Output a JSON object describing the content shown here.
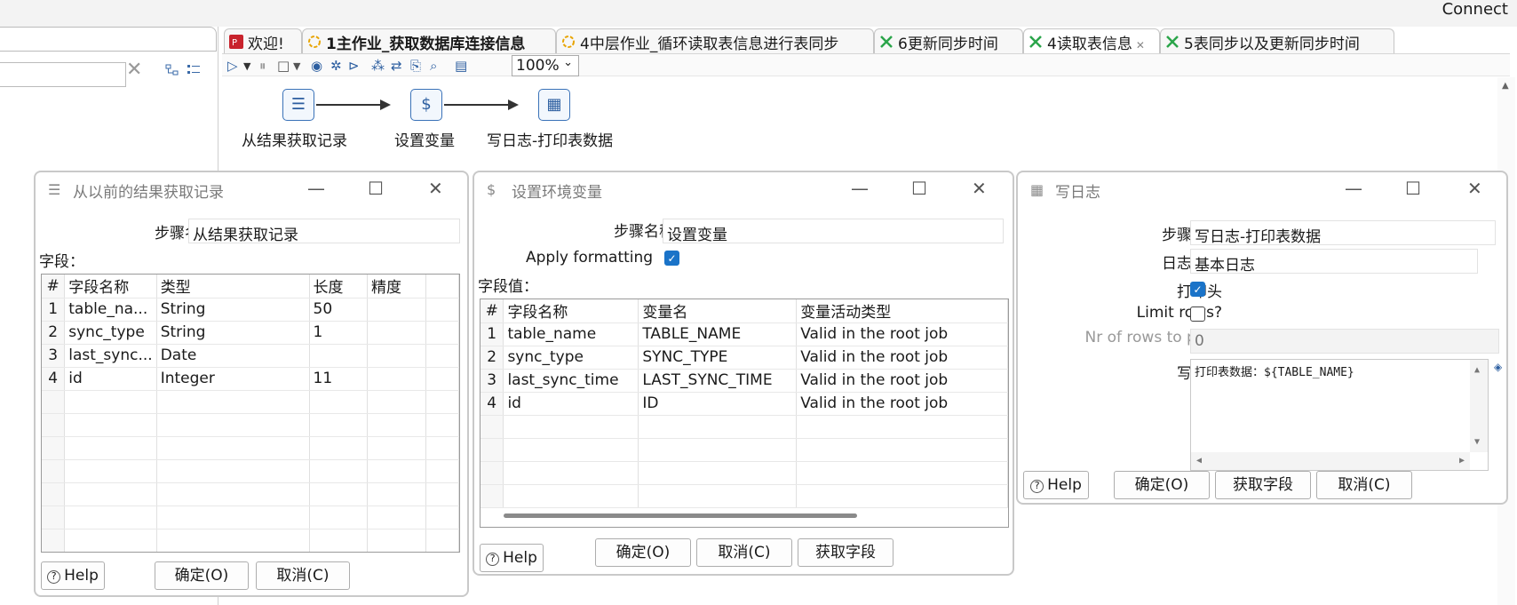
{
  "app": {
    "connect_label": "Connect"
  },
  "tabs": [
    {
      "label": "欢迎!",
      "icon": "welcome-icon",
      "bold": false,
      "active": false
    },
    {
      "label": "1主作业_获取数据库连接信息",
      "icon": "job-icon",
      "bold": true,
      "active": false
    },
    {
      "label": "4中层作业_循环读取表信息进行表同步",
      "icon": "job-icon",
      "bold": false,
      "active": false
    },
    {
      "label": "6更新同步时间",
      "icon": "transformation-icon",
      "bold": false,
      "active": false
    },
    {
      "label": "4读取表信息",
      "icon": "transformation-icon",
      "bold": false,
      "active": true
    },
    {
      "label": "5表同步以及更新同步时间",
      "icon": "transformation-icon",
      "bold": false,
      "active": false
    }
  ],
  "toolbar": {
    "zoom": "100%"
  },
  "canvas": {
    "steps": [
      {
        "label": "从结果获取记录",
        "icon": "get-rows-icon"
      },
      {
        "label": "设置变量",
        "icon": "set-variables-icon"
      },
      {
        "label": "写日志-打印表数据",
        "icon": "write-log-icon"
      }
    ]
  },
  "dialog1": {
    "title": "从以前的结果获取记录",
    "step_name_label": "步骤名称",
    "step_name_value": "从结果获取记录",
    "fields_label": "字段：",
    "columns": [
      "#",
      "字段名称",
      "类型",
      "长度",
      "精度"
    ],
    "rows": [
      [
        "1",
        "table_na...",
        "String",
        "50",
        ""
      ],
      [
        "2",
        "sync_type",
        "String",
        "1",
        ""
      ],
      [
        "3",
        "last_sync...",
        "Date",
        "",
        ""
      ],
      [
        "4",
        "id",
        "Integer",
        "11",
        ""
      ]
    ],
    "help": "Help",
    "ok": "确定(O)",
    "cancel": "取消(C)"
  },
  "dialog2": {
    "title": "设置环境变量",
    "step_name_label": "步骤名称：",
    "step_name_value": "设置变量",
    "apply_formatting_label": "Apply formatting",
    "apply_formatting": true,
    "values_label": "字段值：",
    "columns": [
      "#",
      "字段名称",
      "变量名",
      "变量活动类型"
    ],
    "rows": [
      [
        "1",
        "table_name",
        "TABLE_NAME",
        "Valid in the root job"
      ],
      [
        "2",
        "sync_type",
        "SYNC_TYPE",
        "Valid in the root job"
      ],
      [
        "3",
        "last_sync_time",
        "LAST_SYNC_TIME",
        "Valid in the root job"
      ],
      [
        "4",
        "id",
        "ID",
        "Valid in the root job"
      ]
    ],
    "help": "Help",
    "ok": "确定(O)",
    "cancel": "取消(C)",
    "get_fields": "获取字段"
  },
  "dialog3": {
    "title": "写日志",
    "step_name_label": "步骤名称",
    "step_name_value": "写日志-打印表数据",
    "log_level_label": "日志级别",
    "log_level_value": "基本日志",
    "print_header_label": "打印头",
    "print_header": true,
    "limit_rows_label": "Limit rows?",
    "limit_rows": false,
    "nr_rows_label": "Nr of rows to print",
    "nr_rows_value": "0",
    "log_message_label": "写日志",
    "log_message_value": "打印表数据：${TABLE_NAME}",
    "help": "Help",
    "ok": "确定(O)",
    "get_fields": "获取字段",
    "cancel": "取消(C)"
  },
  "colors": {
    "accent": "#1a73c8",
    "node_border": "#3a72b8"
  }
}
